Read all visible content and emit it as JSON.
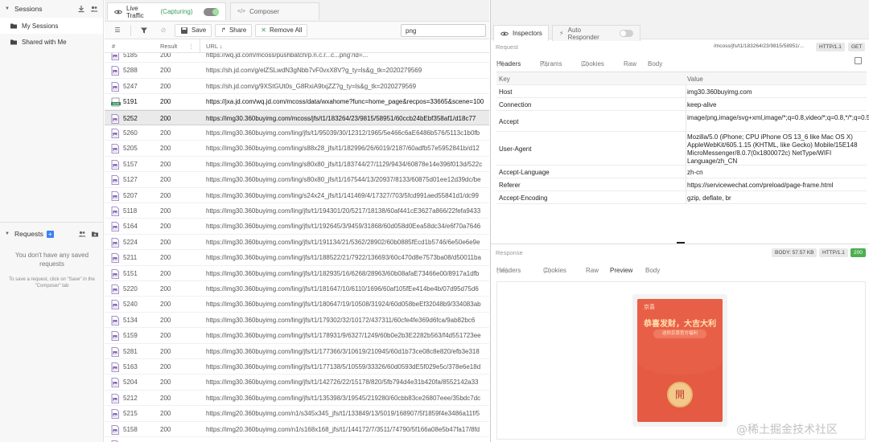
{
  "sidebar": {
    "sessions_title": "Sessions",
    "items": [
      {
        "label": "My Sessions"
      },
      {
        "label": "Shared with Me"
      }
    ],
    "requests_title": "Requests",
    "empty_title": "You don't have any saved requests",
    "empty_hint": "To save a request, click on \"Save\" in the \"Composer\" tab"
  },
  "tabs": {
    "live_traffic": "Live Traffic",
    "capturing": "(Capturing)",
    "composer": "Composer"
  },
  "toolbar": {
    "save": "Save",
    "share": "Share",
    "remove_all": "Remove All",
    "filter_value": "png"
  },
  "table": {
    "columns": [
      "#",
      "Result",
      "URL"
    ],
    "rows": [
      {
        "id": "5185",
        "result": "200",
        "url": "https://wq.jd.com/mcoss/pushbatch/p.n.c.r...c...png?id=...",
        "type": "img"
      },
      {
        "id": "5288",
        "result": "200",
        "url": "https://sh.jd.com/g/elZSLwdN3gNbb7vF0vxX8V?g_ty=ls&g_tk=2020279569",
        "type": "img"
      },
      {
        "id": "5247",
        "result": "200",
        "url": "https://sh.jd.com/g/9XStGUt0s_G8RxiA9txjZZ?g_ty=ls&g_tk=2020279569",
        "type": "img"
      },
      {
        "id": "5191",
        "result": "200",
        "url": "https://jxa.jd.com/wq.jd.com/mcoss/data/wxahome?func=home_page&recpos=33665&scene=100",
        "type": "json",
        "bold": true
      },
      {
        "id": "5252",
        "result": "200",
        "url": "https://img30.360buyimg.com/mcoss/jfs/t1/183264/23/9815/58951/60ccb24bEbf358af1/d18c77",
        "type": "img",
        "selected": true
      },
      {
        "id": "5260",
        "result": "200",
        "url": "https://img30.360buyimg.com/ling/jfs/t1/95039/30/12312/1965/5e466c6aE6486b576/5113c1b0fb",
        "type": "img"
      },
      {
        "id": "5205",
        "result": "200",
        "url": "https://img30.360buyimg.com/ling/s88x28_jfs/t1/182996/26/6019/2187/60adfb57e5952841b/d12",
        "type": "img"
      },
      {
        "id": "5157",
        "result": "200",
        "url": "https://img30.360buyimg.com/ling/s80x80_jfs/t1/183744/27/1129/9434/60878e14e396f013d/522c",
        "type": "img"
      },
      {
        "id": "5127",
        "result": "200",
        "url": "https://img30.360buyimg.com/ling/s80x80_jfs/t1/167544/13/20937/8133/60875d01ee12d39dc/be",
        "type": "img"
      },
      {
        "id": "5207",
        "result": "200",
        "url": "https://img30.360buyimg.com/ling/s24x24_jfs/t1/141469/4/17327/703/5fcd991aed55841d1/dc99",
        "type": "img"
      },
      {
        "id": "5118",
        "result": "200",
        "url": "https://img30.360buyimg.com/ling/jfs/t1/194301/20/5217/18138/60af441cE3627a866/22fefa9433",
        "type": "img"
      },
      {
        "id": "5164",
        "result": "200",
        "url": "https://img30.360buyimg.com/ling/jfs/t1/192645/3/9459/31868/60d058d0Eea58dc34/e6f70a7646",
        "type": "img"
      },
      {
        "id": "5224",
        "result": "200",
        "url": "https://img30.360buyimg.com/ling/jfs/t1/191134/21/5362/28902/60b0885fEcd1b5746/6e50e6e9e",
        "type": "img"
      },
      {
        "id": "5211",
        "result": "200",
        "url": "https://img30.360buyimg.com/ling/jfs/t1/188522/21/7922/136693/60c470d8e7573ba08/d50011ba",
        "type": "img"
      },
      {
        "id": "5151",
        "result": "200",
        "url": "https://img30.360buyimg.com/ling/jfs/t1/182935/16/6268/28963/60b08afaE73466e00/8917a1dfb",
        "type": "img"
      },
      {
        "id": "5220",
        "result": "200",
        "url": "https://img30.360buyimg.com/ling/jfs/t1/181647/10/6110/1696/60af105fEe414be4b/07d95d75d6",
        "type": "img"
      },
      {
        "id": "5240",
        "result": "200",
        "url": "https://img30.360buyimg.com/ling/jfs/t1/180647/19/10508/31924/60d058beEf32048b9/334083ab",
        "type": "img"
      },
      {
        "id": "5134",
        "result": "200",
        "url": "https://img30.360buyimg.com/ling/jfs/t1/179302/32/10172/437311/60cfe4fe369d6fca/9ab82bc6",
        "type": "img"
      },
      {
        "id": "5159",
        "result": "200",
        "url": "https://img30.360buyimg.com/ling/jfs/t1/178931/9/6327/1249/60b0e2b3E2282b563/f4d551723ee",
        "type": "img"
      },
      {
        "id": "5281",
        "result": "200",
        "url": "https://img30.360buyimg.com/ling/jfs/t1/177366/3/10619/210945/60d1b73ce08c8e820/efb3e318",
        "type": "img"
      },
      {
        "id": "5163",
        "result": "200",
        "url": "https://img30.360buyimg.com/ling/jfs/t1/177138/5/10559/33326/60d0593dE5f029e5c/378e6e18d",
        "type": "img"
      },
      {
        "id": "5204",
        "result": "200",
        "url": "https://img30.360buyimg.com/ling/jfs/t1/142726/22/15178/820/5fb794d4e31b420fa/8552142a33",
        "type": "img"
      },
      {
        "id": "5212",
        "result": "200",
        "url": "https://img30.360buyimg.com/ling/jfs/t1/135398/3/19545/219280/60cbb83ce26807eee/35bdc7dc",
        "type": "img"
      },
      {
        "id": "5215",
        "result": "200",
        "url": "https://img20.360buyimg.com/n1/s345x345_jfs/t1/133849/13/5019/168907/5f1859f4e3486a11f/5",
        "type": "img"
      },
      {
        "id": "5158",
        "result": "200",
        "url": "https://img20.360buyimg.com/n1/s168x168_jfs/t1/144172/7/3511/74790/5f166a08e5b47fa17/8fd",
        "type": "img"
      },
      {
        "id": "5196",
        "result": "200",
        "url": "https://img20.360buyimg.com/ling/jfs/t1/154499/28/13687/3624/5ff6c786Ed69ee83f/b486343b24",
        "type": "img"
      }
    ]
  },
  "right": {
    "tab_inspectors": "Inspectors",
    "tab_auto_responder": "Auto Responder",
    "request_label": "Request",
    "request_path": "/mcoss/jfs/t1/183264/23/9815/58951/...",
    "http_version": "HTTP/1.1",
    "method": "GET",
    "request_tabs": [
      {
        "label": "Headers",
        "count": "(7)"
      },
      {
        "label": "Params",
        "count": "(0)"
      },
      {
        "label": "Cookies",
        "count": "(0)"
      },
      {
        "label": "Raw",
        "count": ""
      },
      {
        "label": "Body",
        "count": ""
      }
    ],
    "header_cols": {
      "key": "Key",
      "value": "Value"
    },
    "headers": [
      {
        "key": "Host",
        "value": "img30.360buyimg.com"
      },
      {
        "key": "Connection",
        "value": "keep-alive"
      },
      {
        "key": "Accept",
        "value": "image/png,image/svg+xml,image/*;q=0.8,video/*;q=0.8,*/*;q=0.5"
      },
      {
        "key": "User-Agent",
        "value": "Mozilla/5.0 (iPhone; CPU iPhone OS 13_6 like Mac OS X) AppleWebKit/605.1.15 (KHTML, like Gecko) Mobile/15E148 MicroMessenger/8.0.7(0x1800072c) NetType/WIFI Language/zh_CN"
      },
      {
        "key": "Accept-Language",
        "value": "zh-cn"
      },
      {
        "key": "Referer",
        "value": "https://servicewechat.com/preload/page-frame.html"
      },
      {
        "key": "Accept-Encoding",
        "value": "gzip, deflate, br"
      }
    ],
    "response_label": "Response",
    "body_size": "BODY: 57.57 KB",
    "resp_http": "HTTP/1.1",
    "status": "200",
    "response_tabs": [
      {
        "label": "Headers",
        "count": "(16)"
      },
      {
        "label": "Cookies",
        "count": "(0)"
      },
      {
        "label": "Raw",
        "count": ""
      },
      {
        "label": "Preview",
        "count": ""
      },
      {
        "label": "Body",
        "count": ""
      }
    ],
    "preview": {
      "logo": "京喜",
      "title": "恭喜发财，大吉大利",
      "subtitle": "送你京喜官方福利",
      "button": "開"
    }
  },
  "watermark": "@稀土掘金技术社区",
  "colors": {
    "accent_green": "#3a9c5e",
    "status_green": "#4caf50",
    "envelope_red": "#e45a43"
  }
}
